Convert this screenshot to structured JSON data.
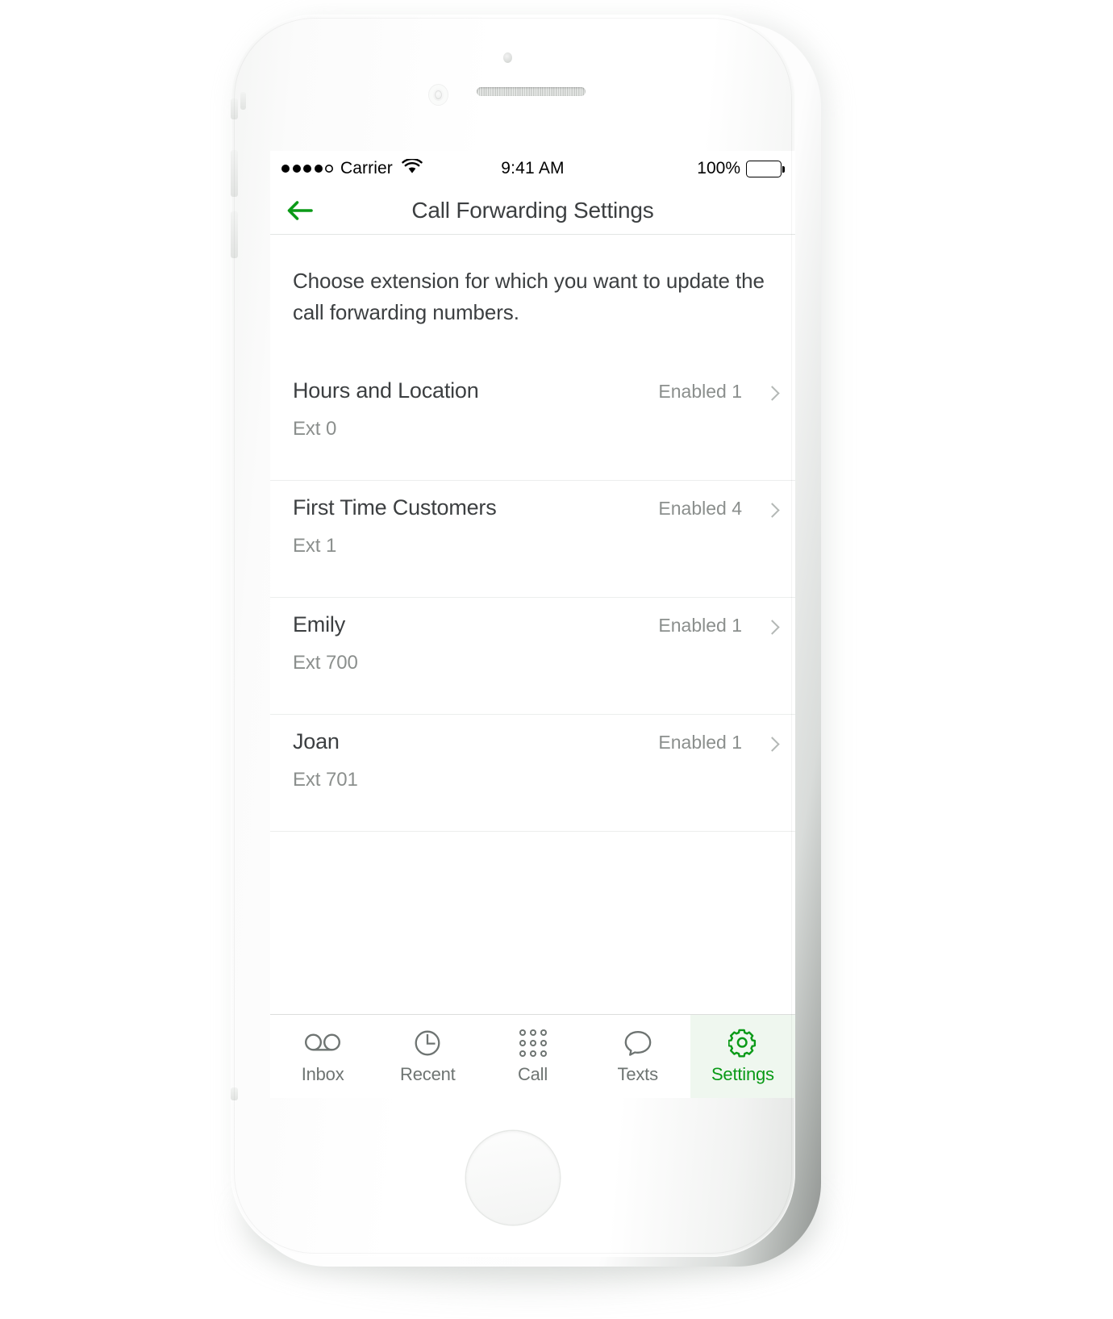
{
  "status_bar": {
    "carrier": "Carrier",
    "signal_dots_filled": 4,
    "signal_dots_total": 5,
    "wifi_icon": "wifi-icon",
    "time": "9:41 AM",
    "battery_percent": "100%",
    "battery_color": "#4cd964"
  },
  "nav": {
    "back_icon": "back-arrow-icon",
    "title": "Call Forwarding Settings",
    "accent_color": "#0a9a17"
  },
  "main": {
    "intro": "Choose extension for which you want to update the call forwarding numbers.",
    "extensions": [
      {
        "name": "Hours and Location",
        "ext": "Ext 0",
        "status": "Enabled 1"
      },
      {
        "name": "First Time Customers",
        "ext": "Ext 1",
        "status": "Enabled 4"
      },
      {
        "name": "Emily",
        "ext": "Ext 700",
        "status": "Enabled 1"
      },
      {
        "name": "Joan",
        "ext": "Ext 701",
        "status": "Enabled 1"
      }
    ]
  },
  "tab_bar": {
    "active_index": 4,
    "active_bg": "#eff7ef",
    "active_color": "#0a9a17",
    "tabs": [
      {
        "label": "Inbox",
        "icon": "voicemail-icon"
      },
      {
        "label": "Recent",
        "icon": "clock-icon"
      },
      {
        "label": "Call",
        "icon": "dialpad-icon"
      },
      {
        "label": "Texts",
        "icon": "speech-bubble-icon"
      },
      {
        "label": "Settings",
        "icon": "gear-icon"
      }
    ]
  }
}
